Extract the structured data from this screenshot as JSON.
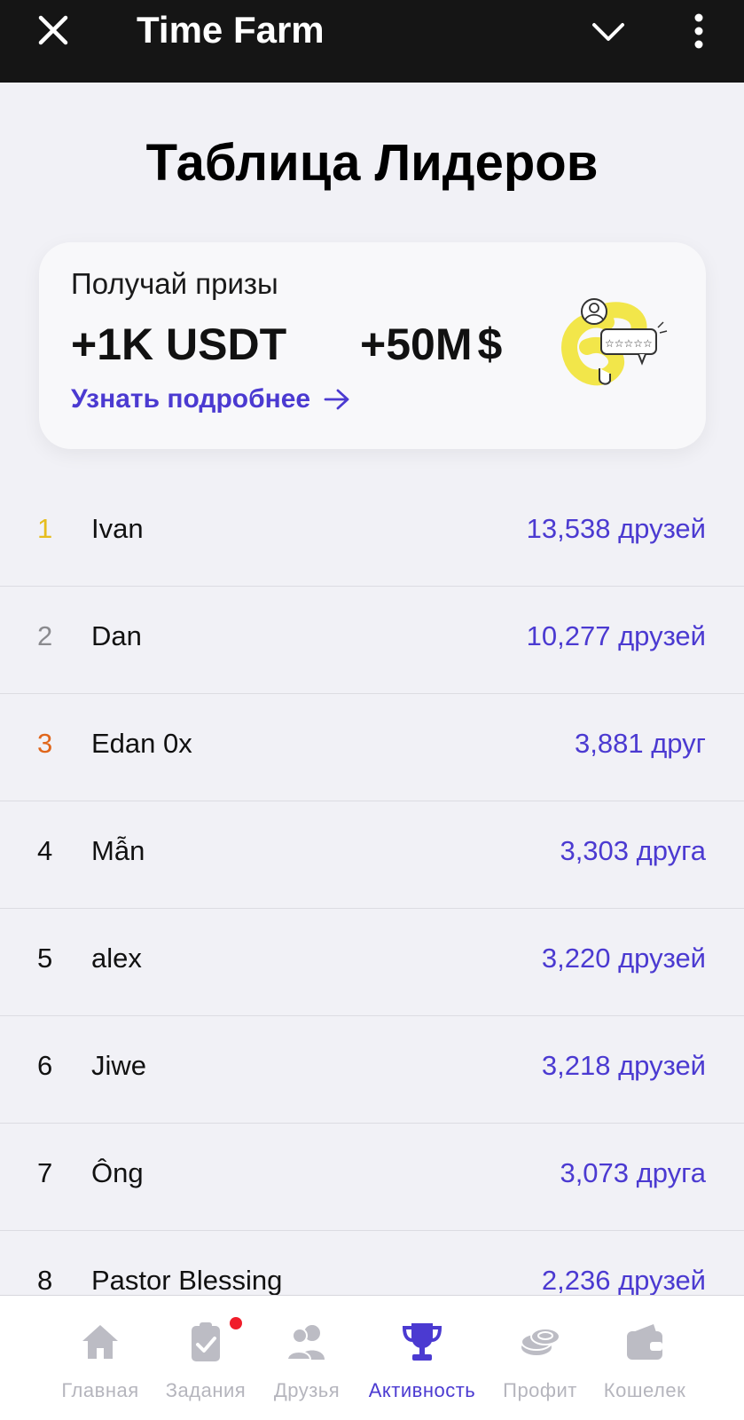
{
  "topbar": {
    "title": "Time Farm"
  },
  "page_title": "Таблица Лидеров",
  "promo": {
    "label": "Получай призы",
    "usdt_prize": "+1K USDT",
    "coin_prize": "+50M",
    "coin_symbol": "$",
    "link_text": "Узнать подробнее"
  },
  "leaderboard": [
    {
      "rank": "1",
      "name": "Ivan",
      "count": "13,538 друзей",
      "rank_color": "#e6bd1d"
    },
    {
      "rank": "2",
      "name": "Dan",
      "count": "10,277 друзей",
      "rank_color": "#8a8a8e"
    },
    {
      "rank": "3",
      "name": "Edan 0x",
      "count": "3,881 друг",
      "rank_color": "#e0661b"
    },
    {
      "rank": "4",
      "name": "Mẫn",
      "count": "3,303 друга",
      "rank_color": "#111111"
    },
    {
      "rank": "5",
      "name": "alex",
      "count": "3,220 друзей",
      "rank_color": "#111111"
    },
    {
      "rank": "6",
      "name": "Jiwe",
      "count": "3,218 друзей",
      "rank_color": "#111111"
    },
    {
      "rank": "7",
      "name": "Ông",
      "count": "3,073 друга",
      "rank_color": "#111111"
    },
    {
      "rank": "8",
      "name": "Pastor Blessing",
      "count": "2,236 друзей",
      "rank_color": "#111111"
    }
  ],
  "nav": {
    "items": [
      {
        "label": "Главная",
        "icon": "home-icon"
      },
      {
        "label": "Задания",
        "icon": "clipboard-check-icon"
      },
      {
        "label": "Друзья",
        "icon": "users-icon"
      },
      {
        "label": "Активность",
        "icon": "trophy-icon"
      },
      {
        "label": "Профит",
        "icon": "coins-icon"
      },
      {
        "label": "Кошелек",
        "icon": "wallet-icon"
      }
    ],
    "active_index": 3
  },
  "colors": {
    "accent": "#4b3ad1",
    "inactive": "#b5b5bd",
    "notification": "#f01d2a"
  }
}
